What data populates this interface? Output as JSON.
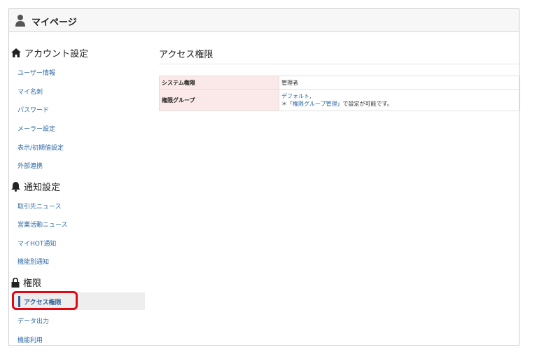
{
  "header": {
    "title": "マイページ"
  },
  "sidebar": {
    "sections": [
      {
        "heading": "アカウント設定",
        "icon": "home-icon",
        "items": [
          "ユーザー情報",
          "マイ名刺",
          "パスワード",
          "メーラー設定",
          "表示/初期値設定",
          "外部連携"
        ]
      },
      {
        "heading": "通知設定",
        "icon": "bell-icon",
        "items": [
          "取引先ニュース",
          "営業活動ニュース",
          "マイHOT通知",
          "機能別通知"
        ]
      },
      {
        "heading": "権限",
        "icon": "lock-icon",
        "items": [
          "アクセス権限",
          "データ出力",
          "機能利用"
        ]
      }
    ],
    "active_item": "アクセス権限"
  },
  "main": {
    "title": "アクセス権限",
    "rows": [
      {
        "label": "システム権限",
        "value": "管理者"
      },
      {
        "label": "権限グループ",
        "value_link": "デフォルト",
        "value_suffix": ",",
        "note_prefix": "＊「",
        "note_link": "権限グループ管理",
        "note_suffix": "」で設定が可能です。"
      }
    ]
  },
  "colors": {
    "link": "#2f6aa5",
    "label_bg": "#fbe9e9",
    "highlight": "#e30613",
    "active_bar": "#2f5f9a"
  }
}
